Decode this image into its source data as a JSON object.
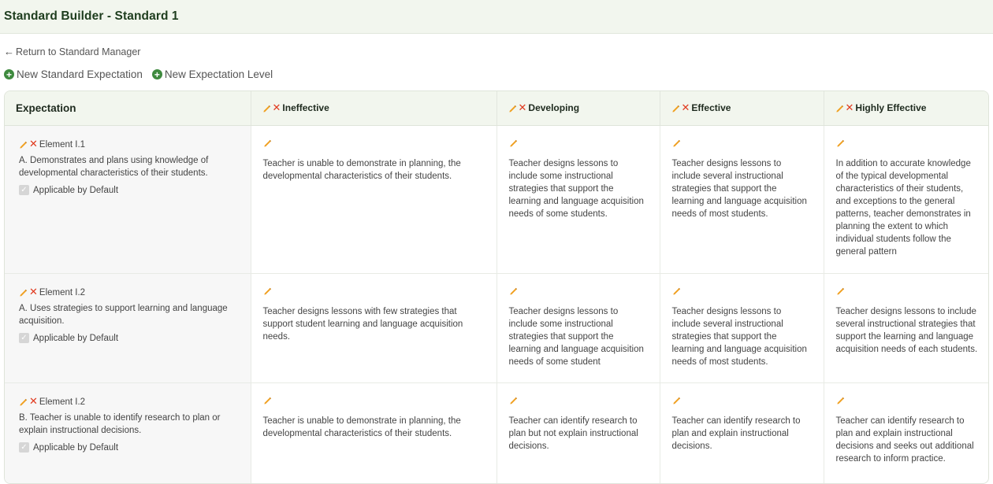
{
  "header": {
    "title": "Standard Builder - Standard 1"
  },
  "nav": {
    "back_label": "Return to Standard Manager"
  },
  "actions": {
    "new_expectation_label": "New Standard Expectation",
    "new_level_label": "New Expectation Level"
  },
  "table": {
    "expectation_header": "Expectation",
    "levels": [
      "Ineffective",
      "Developing",
      "Effective",
      "Highly Effective"
    ],
    "rows": [
      {
        "element": "Element I.1",
        "description": "A. Demonstrates and plans using knowledge of developmental characteristics of their students.",
        "applicable_label": "Applicable by Default",
        "cells": [
          "Teacher is unable to demonstrate in planning, the developmental characteristics of their students.",
          "Teacher designs lessons to include some instructional strategies that support the learning and language acquisition needs of some students.",
          "Teacher designs lessons to include several instructional strategies that support the learning and language acquisition needs of most students.",
          "In addition to accurate knowledge of the typical developmental characteristics of their students, and exceptions to the general patterns, teacher demonstrates in planning the extent to which individual students follow the general pattern"
        ]
      },
      {
        "element": "Element I.2",
        "description": "A. Uses strategies to support learning and language acquisition.",
        "applicable_label": "Applicable by Default",
        "cells": [
          "Teacher designs lessons with few strategies that support student learning and language acquisition needs.",
          "Teacher designs lessons to include some instructional strategies that support the learning and language acquisition needs of some student",
          "Teacher designs lessons to include several instructional strategies that support the learning and language acquisition needs of most students.",
          "Teacher designs lessons to include several instructional strategies that support the learning and language acquisition needs of each students."
        ]
      },
      {
        "element": "Element I.2",
        "description": "B. Teacher is unable to identify research to plan or explain instructional decisions.",
        "applicable_label": "Applicable by Default",
        "cells": [
          "Teacher is unable to demonstrate in planning, the developmental characteristics of their students.",
          "Teacher can identify research to plan but not explain instructional decisions.",
          "Teacher can identify research to plan and explain instructional decisions.",
          "Teacher can identify research to plan and explain instructional decisions and seeks out additional research to inform practice."
        ]
      }
    ]
  },
  "colors": {
    "accent": "#3e8a3e",
    "delete": "#e03a1f",
    "pencil": "#f0a020",
    "header_bg": "#f2f6ee"
  },
  "icons": {
    "edit": "pencil-icon",
    "delete": "delete-x-icon",
    "add": "plus-circle-icon",
    "back": "arrow-left-icon",
    "checkbox": "checkbox-checked"
  }
}
